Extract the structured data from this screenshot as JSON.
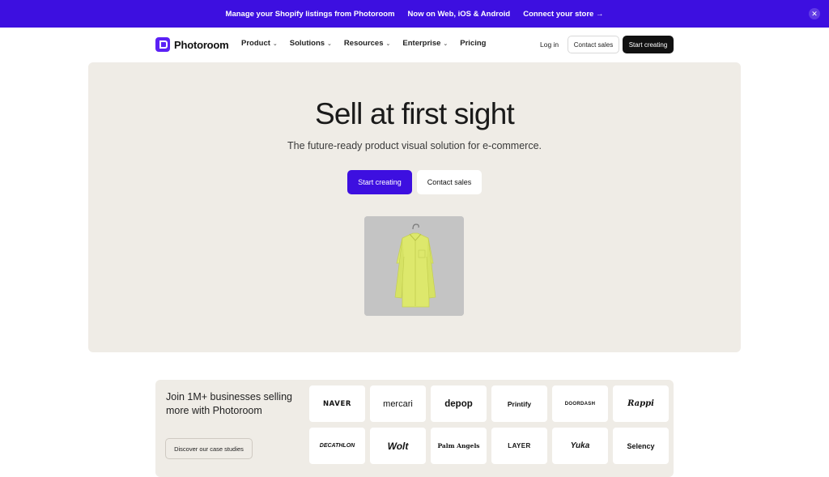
{
  "banner": {
    "text1": "Manage your Shopify listings from Photoroom",
    "text2": "Now on Web, iOS & Android",
    "link": "Connect your store →",
    "close": "✕"
  },
  "nav": {
    "brand": "Photoroom",
    "menu": [
      "Product",
      "Solutions",
      "Resources",
      "Enterprise",
      "Pricing"
    ],
    "chevron": "⌄",
    "login": "Log in",
    "contact": "Contact sales",
    "start": "Start creating"
  },
  "hero": {
    "title": "Sell at first sight",
    "subtitle": "The future-ready product visual solution for e-commerce.",
    "primary_button": "Start creating",
    "secondary_button": "Contact sales",
    "image_icon": "yellow-shirt-on-hanger"
  },
  "proof": {
    "title": "Join 1M+ businesses selling more with Photoroom",
    "case_button": "Discover our case studies",
    "logos": [
      "NAVER",
      "mercari",
      "depop",
      "Printify",
      "DOORDASH",
      "Rappi",
      "DECATHLON",
      "Wolt",
      "Palm Angels",
      "LAYER",
      "Yuka",
      "Selency"
    ]
  },
  "colors": {
    "accent": "#3d0fe0",
    "hero_bg": "#efece6",
    "dark": "#111111"
  }
}
